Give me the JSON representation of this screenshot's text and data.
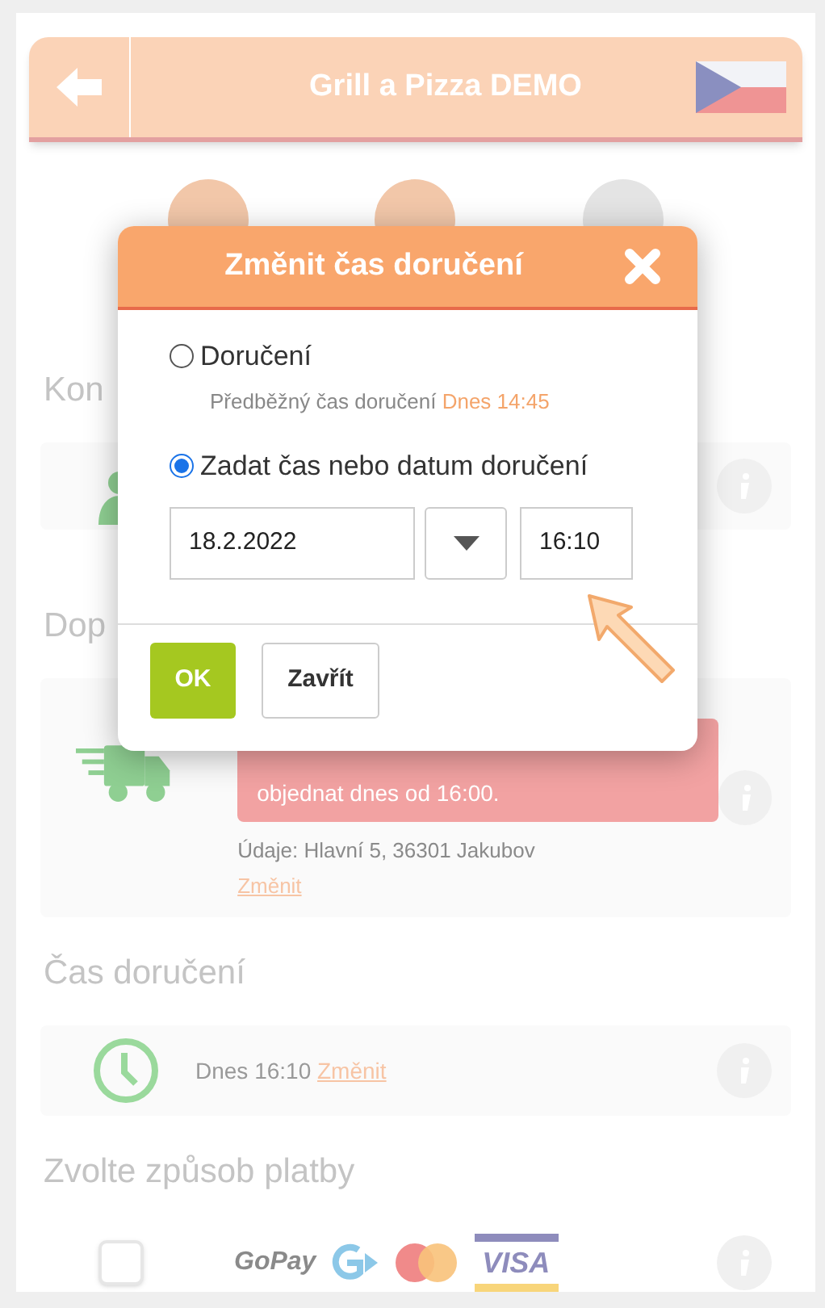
{
  "header": {
    "title": "Grill a Pizza DEMO"
  },
  "steps": [
    {
      "selected": true
    },
    {
      "selected": true
    },
    {
      "selected": false
    }
  ],
  "sections": [
    {
      "heading": "Kon",
      "kind": "contact"
    },
    {
      "heading": "Dop",
      "kind": "delivery",
      "alert": "objednat dnes od 16:00.",
      "details": "Údaje: Hlavní 5, 36301 Jakubov",
      "link": "Změnit"
    },
    {
      "heading": "Čas doručení",
      "kind": "time",
      "value": "Dnes 16:10",
      "link": "Změnit"
    },
    {
      "heading": "Zvolte způsob platby",
      "kind": "payment",
      "checked": false,
      "gopay": "GoPay",
      "visa": "VISA"
    }
  ],
  "dialog": {
    "title": "Změnit čas doručení",
    "options": [
      {
        "label": "Doručení",
        "selected": false,
        "note": "Předběžný čas doručení",
        "note_value": "Dnes 14:45"
      },
      {
        "label": "Zadat čas nebo datum doručení",
        "selected": true
      }
    ],
    "date": "18.2.2022",
    "time": "16:10",
    "ok": "OK",
    "close": "Zavřít"
  }
}
